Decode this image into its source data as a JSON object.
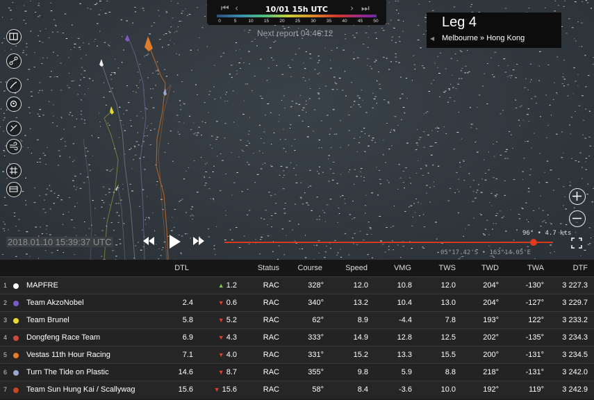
{
  "timebar": {
    "date": "10/01 15h UTC",
    "first": "⏮",
    "prev": "‹",
    "next": "›",
    "last": "⏭",
    "scale_labels": [
      "0",
      "5",
      "10",
      "15",
      "20",
      "25",
      "30",
      "35",
      "40",
      "45",
      "50"
    ]
  },
  "next_report": "Next report 04:46:12",
  "leg": {
    "title": "Leg 4",
    "route": "Melbourne » Hong Kong"
  },
  "timestamp": "2018.01.10 15:39:37 UTC",
  "wind_readout": "96° • 4.7 kts",
  "coords": "05°17.42'S • 163°14.05'E",
  "tools": [
    "map-book-icon",
    "route-icon",
    "wind-lines-icon",
    "sail-face-icon",
    "compass-icon",
    "wind-gust-icon",
    "grid-icon",
    "table-icon"
  ],
  "colors": {
    "slider": "#d8391c",
    "up": "#7ec850",
    "down": "#e0412a"
  },
  "table": {
    "headers": {
      "dtl": "DTL",
      "status": "Status",
      "course": "Course",
      "speed": "Speed",
      "vmg": "VMG",
      "tws": "TWS",
      "twd": "TWD",
      "twa": "TWA",
      "dtf": "DTF"
    },
    "rows": [
      {
        "rank": "1",
        "color": "#ffffff",
        "name": "MAPFRE",
        "dtl": "",
        "trend": "up",
        "change": "1.2",
        "status": "RAC",
        "course": "328°",
        "speed": "12.0",
        "vmg": "10.8",
        "tws": "12.0",
        "twd": "204°",
        "twa": "-130°",
        "dtf": "3 227.3"
      },
      {
        "rank": "2",
        "color": "#7a5cc4",
        "name": "Team AkzoNobel",
        "dtl": "2.4",
        "trend": "down",
        "change": "0.6",
        "status": "RAC",
        "course": "340°",
        "speed": "13.2",
        "vmg": "10.4",
        "tws": "13.0",
        "twd": "204°",
        "twa": "-127°",
        "dtf": "3 229.7"
      },
      {
        "rank": "3",
        "color": "#e8d930",
        "name": "Team Brunel",
        "dtl": "5.8",
        "trend": "down",
        "change": "5.2",
        "status": "RAC",
        "course": "62°",
        "speed": "8.9",
        "vmg": "-4.4",
        "tws": "7.8",
        "twd": "193°",
        "twa": "122°",
        "dtf": "3 233.2"
      },
      {
        "rank": "4",
        "color": "#c84a3a",
        "name": "Dongfeng Race Team",
        "dtl": "6.9",
        "trend": "down",
        "change": "4.3",
        "status": "RAC",
        "course": "333°",
        "speed": "14.9",
        "vmg": "12.8",
        "tws": "12.5",
        "twd": "202°",
        "twa": "-135°",
        "dtf": "3 234.3"
      },
      {
        "rank": "5",
        "color": "#e87b2a",
        "name": "Vestas 11th Hour Racing",
        "dtl": "7.1",
        "trend": "down",
        "change": "4.0",
        "status": "RAC",
        "course": "331°",
        "speed": "15.2",
        "vmg": "13.3",
        "tws": "15.5",
        "twd": "200°",
        "twa": "-131°",
        "dtf": "3 234.5"
      },
      {
        "rank": "6",
        "color": "#9ba7d0",
        "name": "Turn The Tide on Plastic",
        "dtl": "14.6",
        "trend": "down",
        "change": "8.7",
        "status": "RAC",
        "course": "355°",
        "speed": "9.8",
        "vmg": "5.9",
        "tws": "8.8",
        "twd": "218°",
        "twa": "-131°",
        "dtf": "3 242.0"
      },
      {
        "rank": "7",
        "color": "#c4451f",
        "name": "Team Sun Hung Kai / Scallywag",
        "dtl": "15.6",
        "trend": "down",
        "change": "15.6",
        "status": "RAC",
        "course": "58°",
        "speed": "8.4",
        "vmg": "-3.6",
        "tws": "10.0",
        "twd": "192°",
        "twa": "119°",
        "dtf": "3 242.9"
      }
    ]
  }
}
